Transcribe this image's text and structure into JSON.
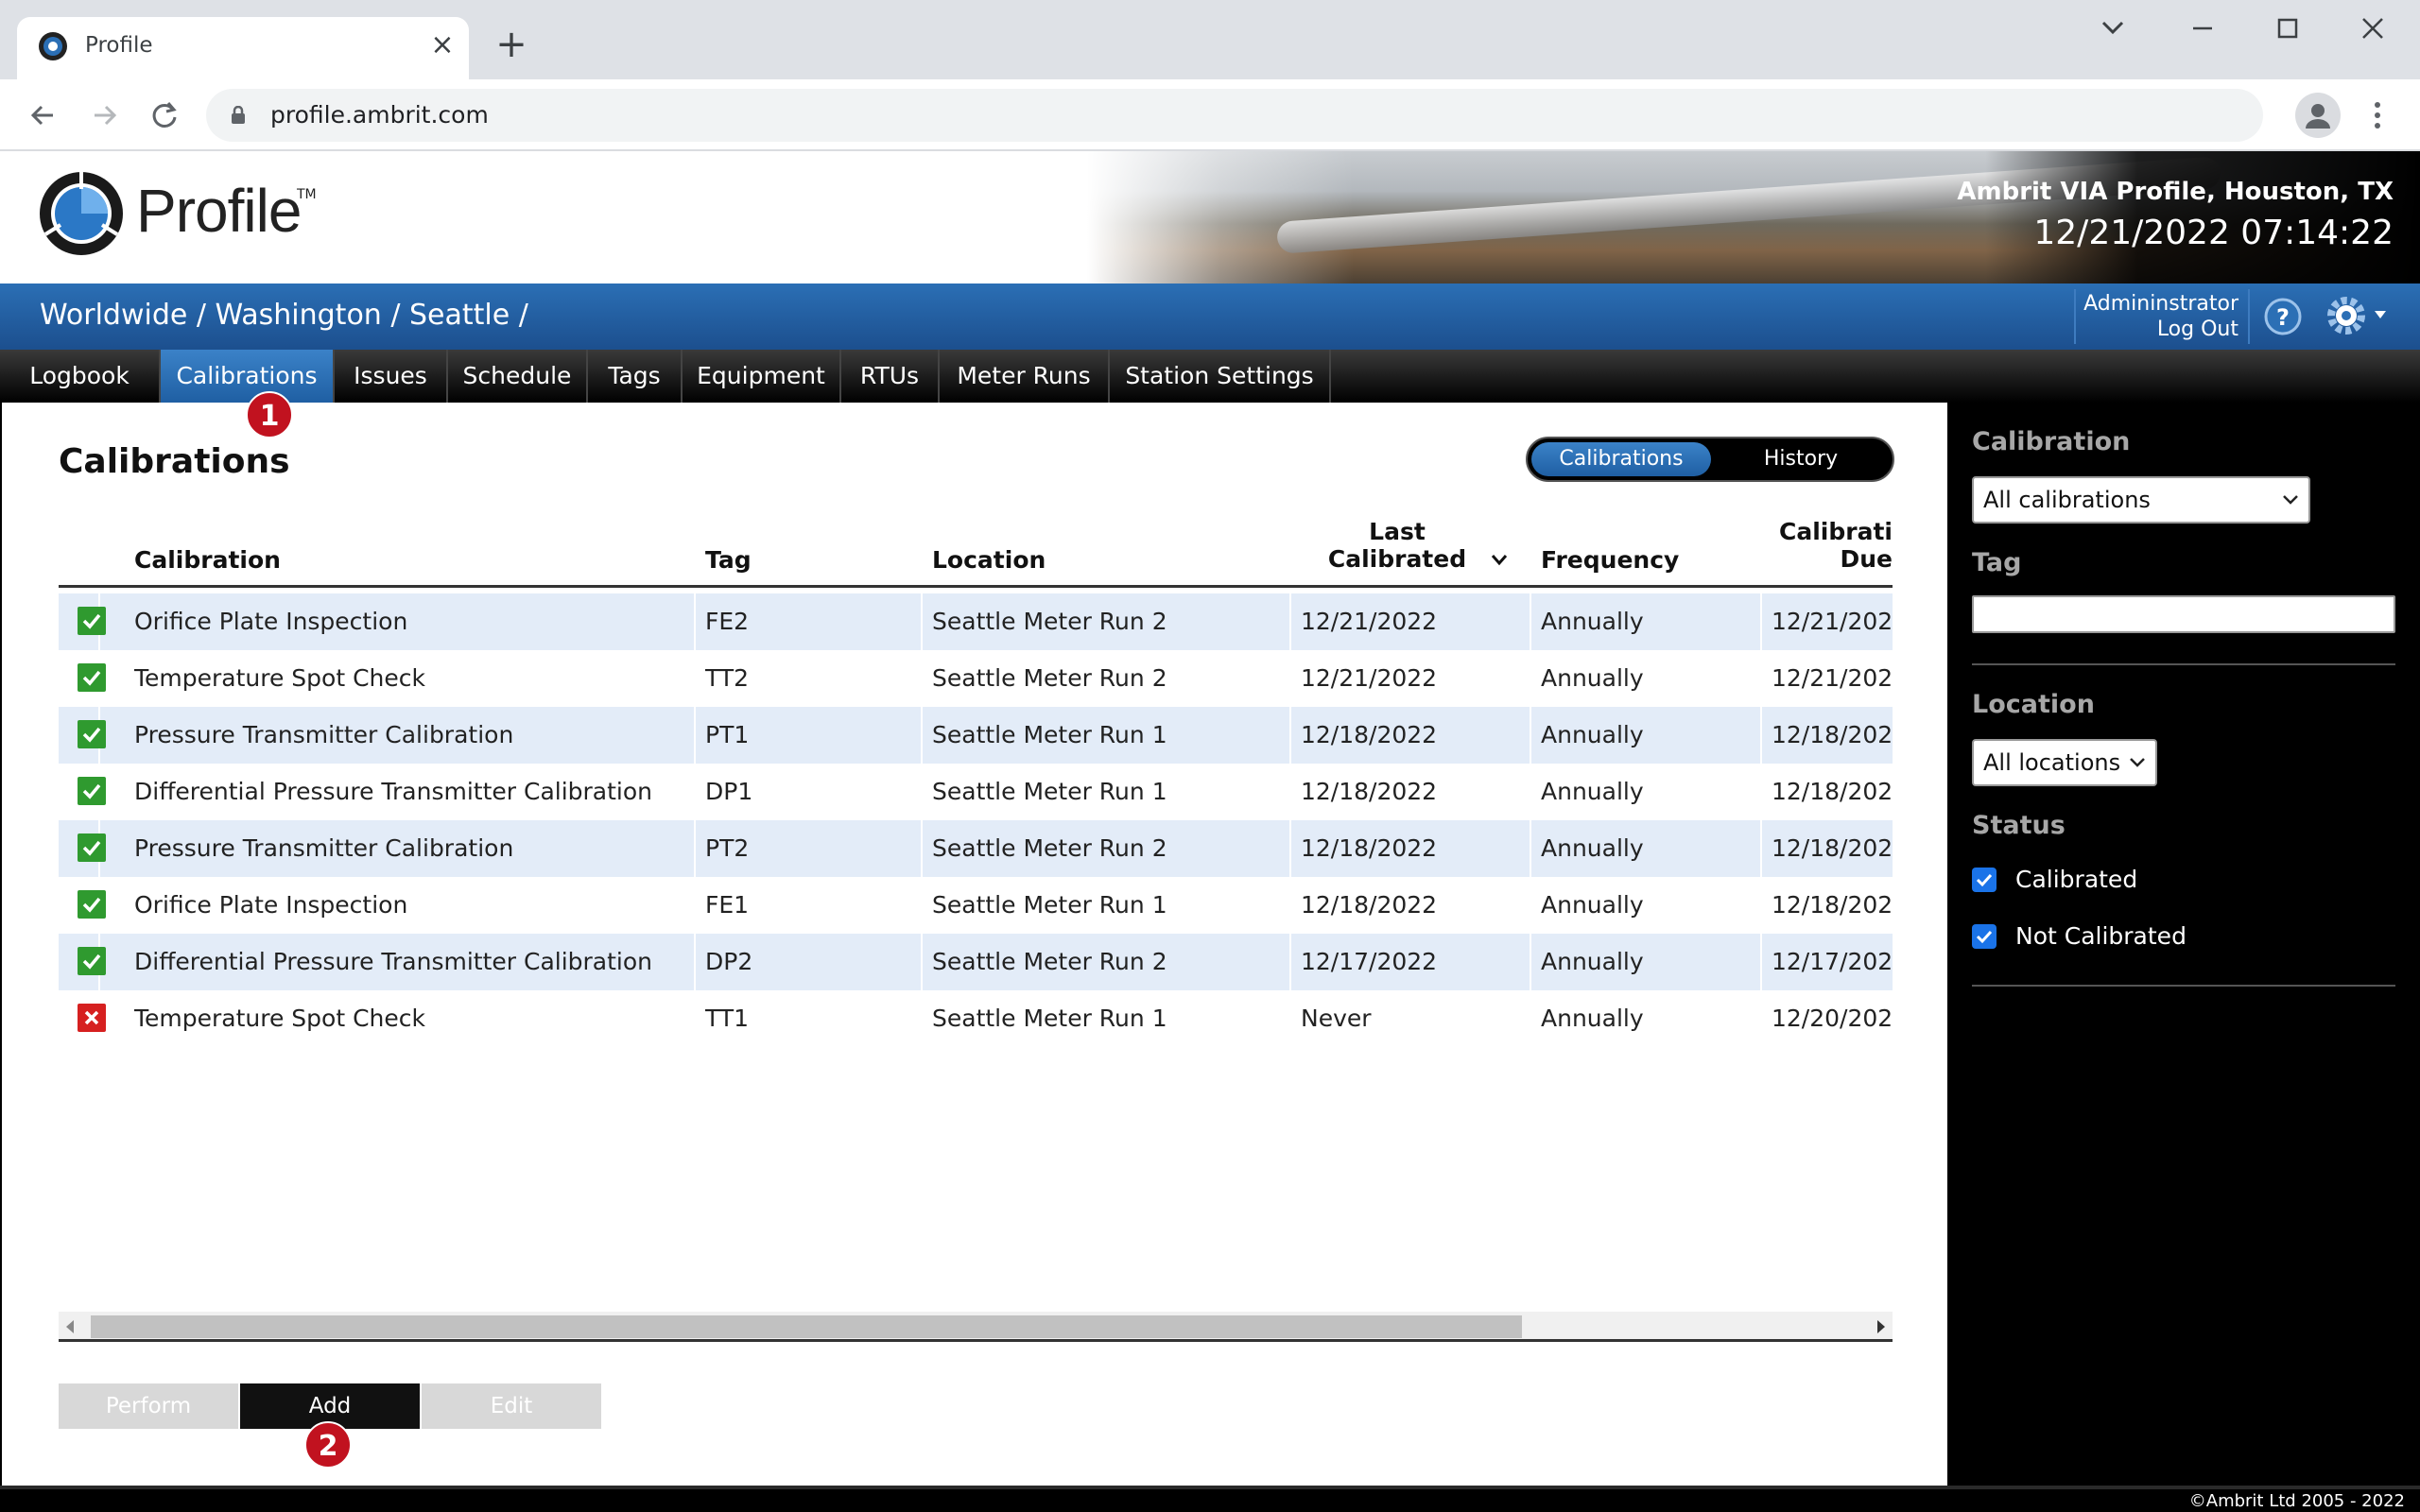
{
  "browser": {
    "tab_title": "Profile",
    "url": "profile.ambrit.com"
  },
  "header": {
    "logo_text": "Profile",
    "logo_tm": "TM",
    "site_name": "Ambrit VIA Profile, Houston, TX",
    "clock": "12/21/2022 07:14:22"
  },
  "crumbs": {
    "path": "Worldwide / Washington / Seattle /",
    "user": "Admininstrator",
    "logout": "Log Out"
  },
  "nav": {
    "items": [
      "Logbook",
      "Calibrations",
      "Issues",
      "Schedule",
      "Tags",
      "Equipment",
      "RTUs",
      "Meter Runs",
      "Station Settings"
    ],
    "active": "Calibrations"
  },
  "main": {
    "title": "Calibrations",
    "toggle": [
      "Calibrations",
      "History"
    ],
    "columns": {
      "calibration": "Calibration",
      "tag": "Tag",
      "location": "Location",
      "last_cal_1": "Last",
      "last_cal_2": "Calibrated",
      "frequency": "Frequency",
      "due_1": "Calibrati",
      "due_2": "Due"
    },
    "rows": [
      {
        "status": "ok",
        "calibration": "Orifice Plate Inspection",
        "tag": "FE2",
        "location": "Seattle Meter Run 2",
        "last": "12/21/2022",
        "frequency": "Annually",
        "due": "12/21/202"
      },
      {
        "status": "ok",
        "calibration": "Temperature Spot Check",
        "tag": "TT2",
        "location": "Seattle Meter Run 2",
        "last": "12/21/2022",
        "frequency": "Annually",
        "due": "12/21/202"
      },
      {
        "status": "ok",
        "calibration": "Pressure Transmitter Calibration",
        "tag": "PT1",
        "location": "Seattle Meter Run 1",
        "last": "12/18/2022",
        "frequency": "Annually",
        "due": "12/18/202"
      },
      {
        "status": "ok",
        "calibration": "Differential Pressure Transmitter Calibration",
        "tag": "DP1",
        "location": "Seattle Meter Run 1",
        "last": "12/18/2022",
        "frequency": "Annually",
        "due": "12/18/202"
      },
      {
        "status": "ok",
        "calibration": "Pressure Transmitter Calibration",
        "tag": "PT2",
        "location": "Seattle Meter Run 2",
        "last": "12/18/2022",
        "frequency": "Annually",
        "due": "12/18/202"
      },
      {
        "status": "ok",
        "calibration": "Orifice Plate Inspection",
        "tag": "FE1",
        "location": "Seattle Meter Run 1",
        "last": "12/18/2022",
        "frequency": "Annually",
        "due": "12/18/202"
      },
      {
        "status": "ok",
        "calibration": "Differential Pressure Transmitter Calibration",
        "tag": "DP2",
        "location": "Seattle Meter Run 2",
        "last": "12/17/2022",
        "frequency": "Annually",
        "due": "12/17/202"
      },
      {
        "status": "bad",
        "calibration": "Temperature Spot Check",
        "tag": "TT1",
        "location": "Seattle Meter Run 1",
        "last": "Never",
        "frequency": "Annually",
        "due": "12/20/202"
      }
    ],
    "buttons": {
      "perform": "Perform",
      "add": "Add",
      "edit": "Edit"
    },
    "markers": {
      "one": "1",
      "two": "2"
    }
  },
  "filters": {
    "calibration_label": "Calibration",
    "calibration_value": "All calibrations",
    "tag_label": "Tag",
    "tag_value": "",
    "location_label": "Location",
    "location_value": "All locations",
    "status_label": "Status",
    "status_options": [
      {
        "label": "Calibrated",
        "checked": true
      },
      {
        "label": "Not Calibrated",
        "checked": true
      }
    ]
  },
  "footer": {
    "copyright": "©Ambrit Ltd 2005 - 2022"
  },
  "colors": {
    "accent_blue": "#1f5fa3",
    "ok_green": "#2f9a2f",
    "error_red": "#d62020",
    "marker_red": "#c1121f"
  }
}
